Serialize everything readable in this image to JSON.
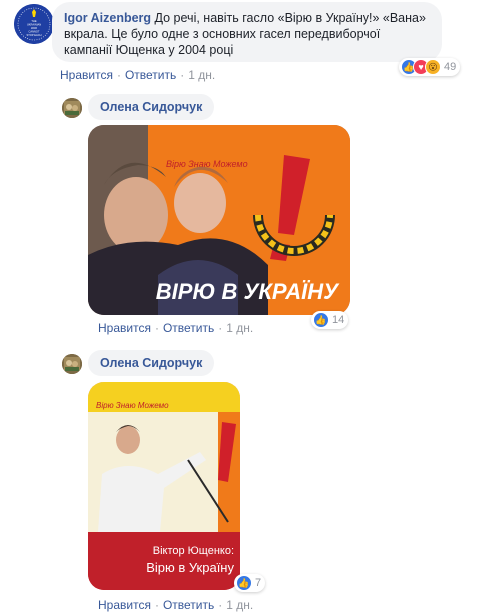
{
  "comment1": {
    "author": "Igor Aizenberg",
    "text": "До речі, навіть гасло «Вірю в Україну!» «Вана» вкрала. Це було одне з основних гасел передвиборчої кампанії Ющенка у 2004 році",
    "reactions_count": "49",
    "actions": {
      "like": "Нравится",
      "reply": "Ответить",
      "time": "1 дн."
    },
    "avatar_text": [
      "THE",
      "UKRAINIAN",
      "WAR",
      "CANNOT",
      "STOP EACH"
    ]
  },
  "comment2": {
    "author": "Олена Сидорчук",
    "reactions_count": "14",
    "actions": {
      "like": "Нравится",
      "reply": "Ответить",
      "time": "1 дн."
    },
    "image": {
      "banner_small": "Вірю Знаю Можемо",
      "banner_big": "ВІРЮ В УКРАЇНУ"
    }
  },
  "comment3": {
    "author": "Олена Сидорчук",
    "reactions_count": "7",
    "actions": {
      "like": "Нравится",
      "reply": "Ответить",
      "time": "1 дн."
    },
    "image": {
      "top_text": "Вірю Знаю Можемо",
      "name_line": "Віктор Ющенко:",
      "slogan_line": "Вірю в Україну"
    }
  },
  "colors": {
    "link": "#385898",
    "bubble": "#f2f3f5",
    "muted": "#90949c",
    "campaign_orange": "#f07a1a",
    "campaign_red": "#c0202a"
  }
}
